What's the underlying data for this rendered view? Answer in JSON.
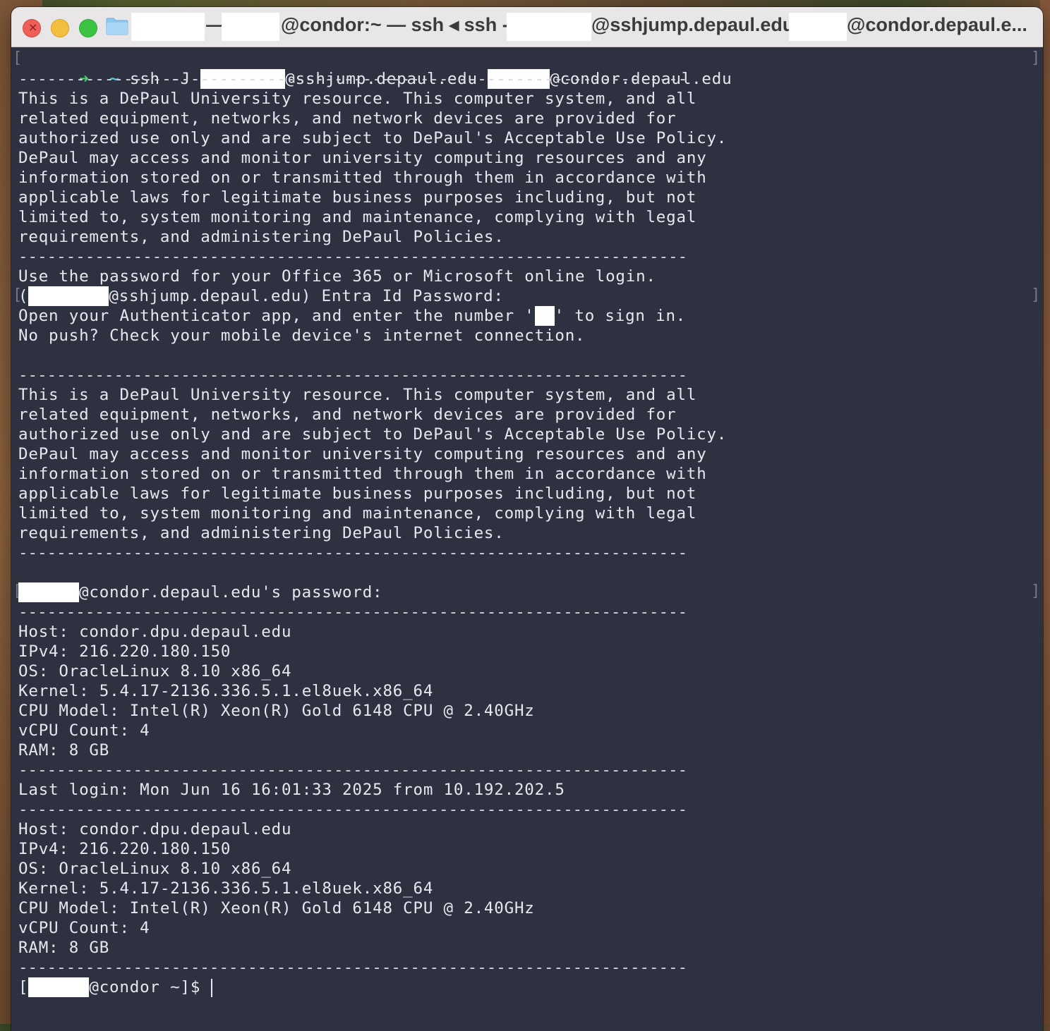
{
  "window": {
    "title_parts": [
      "—",
      "@condor:~ — ssh ◂ ssh -J",
      "@sshjump.depaul.edu",
      "@condor.depaul.e..."
    ],
    "folder_icon": "folder-icon"
  },
  "terminal": {
    "command_line": {
      "prompt": "➜",
      "dir": "~",
      "cmd_prefix": "ssh -J ",
      "cmd_middle": "@sshjump.depaul.edu ",
      "cmd_suffix": "@condor.depaul.edu"
    },
    "separator": "----------------------------------------------------------------------",
    "banner_lines": [
      "This is a DePaul University resource. This computer system, and all",
      "related equipment, networks, and network devices are provided for",
      "authorized use only and are subject to DePaul's Acceptable Use Policy.",
      "DePaul may access and monitor university computing resources and any",
      "information stored on or transmitted through them in accordance with",
      "applicable laws for legitimate business purposes including, but not",
      "limited to, system monitoring and maintenance, complying with legal",
      "requirements, and administering DePaul Policies."
    ],
    "auth": {
      "use_password": "Use the password for your Office 365 or Microsoft online login.",
      "entra_prefix": "(",
      "entra_suffix": "@sshjump.depaul.edu) Entra Id Password:",
      "open_app_prefix": "Open your Authenticator app, and enter the number '",
      "open_app_suffix": "' to sign in.",
      "no_push": "No push? Check your mobile device's internet connection."
    },
    "password_prompt_suffix": "@condor.depaul.edu's password:",
    "sysinfo": [
      "Host: condor.dpu.depaul.edu",
      "IPv4: 216.220.180.150",
      "OS: OracleLinux 8.10 x86_64",
      "Kernel: 5.4.17-2136.336.5.1.el8uek.x86_64",
      "CPU Model: Intel(R) Xeon(R) Gold 6148 CPU @ 2.40GHz",
      "vCPU Count: 4",
      "RAM: 8 GB"
    ],
    "last_login": "Last login: Mon Jun 16 16:01:33 2025 from 10.192.202.5",
    "final_prompt_prefix": "[",
    "final_prompt_suffix": "@condor ~]$ ",
    "line_marker_left": "[",
    "line_marker_right": "]"
  }
}
